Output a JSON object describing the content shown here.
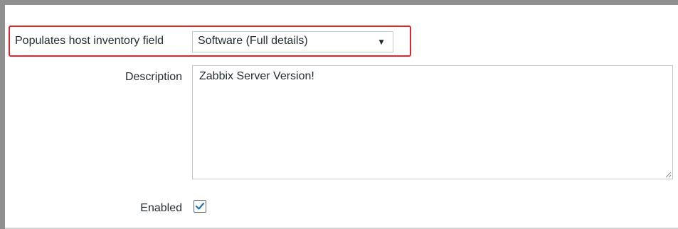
{
  "form": {
    "inventory_field": {
      "label": "Populates host inventory field",
      "selected_value": "Software (Full details)",
      "arrow_icon": "dropdown-arrow-icon"
    },
    "description": {
      "label": "Description",
      "value": "Zabbix Server Version!"
    },
    "enabled": {
      "label": "Enabled",
      "checked": true
    }
  },
  "colors": {
    "highlight": "#e0262a",
    "text": "#1f2c33",
    "check": "#1a75bb",
    "input_border": "#bfcbd3"
  }
}
